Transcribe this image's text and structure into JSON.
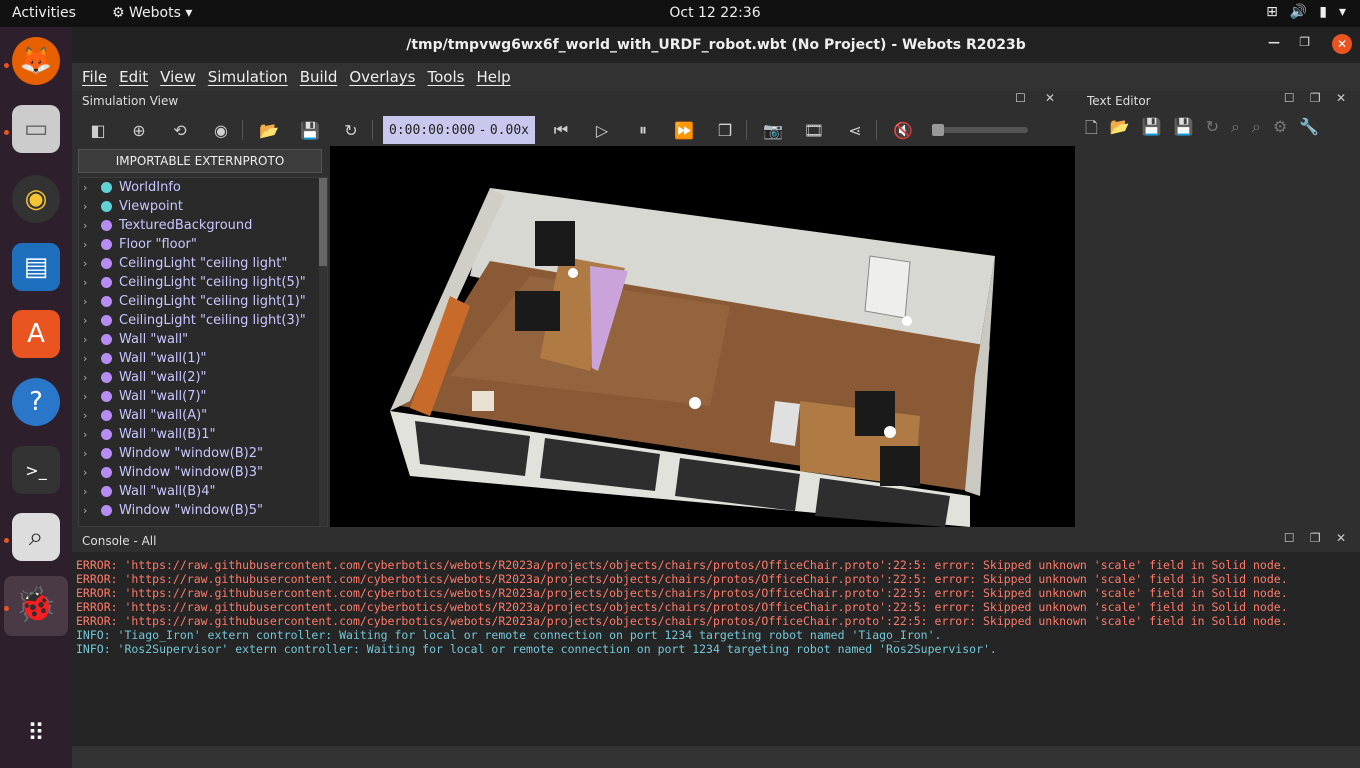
{
  "topbar": {
    "activities": "Activities",
    "app": "Webots",
    "clock": "Oct 12  22:36"
  },
  "window": {
    "title": "/tmp/tmpvwg6wx6f_world_with_URDF_robot.wbt (No Project) - Webots R2023b"
  },
  "menu": [
    "File",
    "Edit",
    "View",
    "Simulation",
    "Build",
    "Overlays",
    "Tools",
    "Help"
  ],
  "sim": {
    "panel_title": "Simulation View",
    "time": "0:00:00:000",
    "dash": "-",
    "speed": "0.00x",
    "importable_button": "IMPORTABLE EXTERNPROTO"
  },
  "tree": [
    {
      "label": "WorldInfo",
      "color": "#5fd3d3"
    },
    {
      "label": "Viewpoint",
      "color": "#5fd3d3"
    },
    {
      "label": "TexturedBackground",
      "color": "#b88cf5"
    },
    {
      "label": "Floor \"floor\"",
      "color": "#b88cf5"
    },
    {
      "label": "CeilingLight \"ceiling light\"",
      "color": "#b88cf5"
    },
    {
      "label": "CeilingLight \"ceiling light(5)\"",
      "color": "#b88cf5"
    },
    {
      "label": "CeilingLight \"ceiling light(1)\"",
      "color": "#b88cf5"
    },
    {
      "label": "CeilingLight \"ceiling light(3)\"",
      "color": "#b88cf5"
    },
    {
      "label": "Wall \"wall\"",
      "color": "#b88cf5"
    },
    {
      "label": "Wall \"wall(1)\"",
      "color": "#b88cf5"
    },
    {
      "label": "Wall \"wall(2)\"",
      "color": "#b88cf5"
    },
    {
      "label": "Wall \"wall(7)\"",
      "color": "#b88cf5"
    },
    {
      "label": "Wall \"wall(A)\"",
      "color": "#b88cf5"
    },
    {
      "label": "Wall \"wall(B)1\"",
      "color": "#b88cf5"
    },
    {
      "label": "Window \"window(B)2\"",
      "color": "#b88cf5"
    },
    {
      "label": "Window \"window(B)3\"",
      "color": "#b88cf5"
    },
    {
      "label": "Wall \"wall(B)4\"",
      "color": "#b88cf5"
    },
    {
      "label": "Window \"window(B)5\"",
      "color": "#b88cf5"
    }
  ],
  "texteditor": {
    "panel_title": "Text Editor"
  },
  "console": {
    "panel_title": "Console - All",
    "lines": [
      {
        "type": "err",
        "text": "ERROR: 'https://raw.githubusercontent.com/cyberbotics/webots/R2023a/projects/objects/chairs/protos/OfficeChair.proto':22:5: error: Skipped unknown 'scale' field in Solid node."
      },
      {
        "type": "err",
        "text": "ERROR: 'https://raw.githubusercontent.com/cyberbotics/webots/R2023a/projects/objects/chairs/protos/OfficeChair.proto':22:5: error: Skipped unknown 'scale' field in Solid node."
      },
      {
        "type": "err",
        "text": "ERROR: 'https://raw.githubusercontent.com/cyberbotics/webots/R2023a/projects/objects/chairs/protos/OfficeChair.proto':22:5: error: Skipped unknown 'scale' field in Solid node."
      },
      {
        "type": "err",
        "text": "ERROR: 'https://raw.githubusercontent.com/cyberbotics/webots/R2023a/projects/objects/chairs/protos/OfficeChair.proto':22:5: error: Skipped unknown 'scale' field in Solid node."
      },
      {
        "type": "err",
        "text": "ERROR: 'https://raw.githubusercontent.com/cyberbotics/webots/R2023a/projects/objects/chairs/protos/OfficeChair.proto':22:5: error: Skipped unknown 'scale' field in Solid node."
      },
      {
        "type": "info",
        "text": "INFO: 'Tiago_Iron' extern controller: Waiting for local or remote connection on port 1234 targeting robot named 'Tiago_Iron'."
      },
      {
        "type": "info",
        "text": "INFO: 'Ros2Supervisor' extern controller: Waiting for local or remote connection on port 1234 targeting robot named 'Ros2Supervisor'."
      }
    ]
  }
}
